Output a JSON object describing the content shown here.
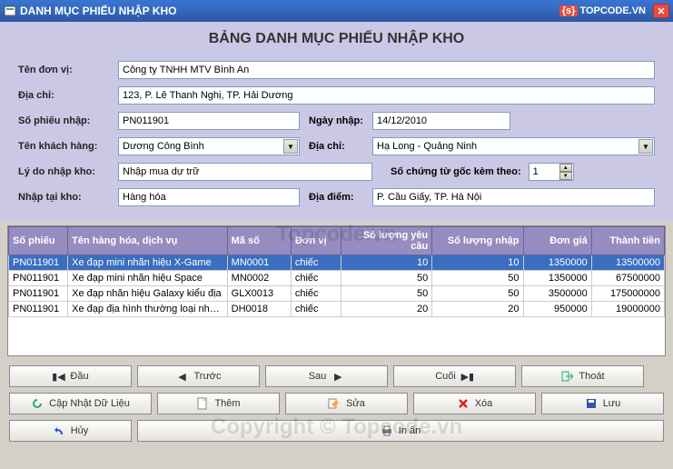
{
  "window": {
    "title": "DANH MỤC PHIẾU NHẬP KHO",
    "logo_text": "TOPCODE.VN"
  },
  "header": "BẢNG DANH MỤC PHIẾU NHẬP KHO",
  "form": {
    "ten_don_vi_label": "Tên đơn vị:",
    "ten_don_vi": "Công ty TNHH MTV Bình An",
    "dia_chi_label": "Địa chỉ:",
    "dia_chi": "123, P. Lê Thanh Nghị, TP. Hải Dương",
    "so_phieu_label": "Số phiếu nhập:",
    "so_phieu": "PN011901",
    "ngay_nhap_label": "Ngày nhập:",
    "ngay_nhap": "14/12/2010",
    "khach_hang_label": "Tên khách hàng:",
    "khach_hang": "Dương Công Bình",
    "dia_chi_kh_label": "Địa chỉ:",
    "dia_chi_kh": "Hạ Long - Quảng Ninh",
    "ly_do_label": "Lý do nhập kho:",
    "ly_do": "Nhập mua dự trữ",
    "chung_tu_label": "Số chứng từ gốc kèm theo:",
    "chung_tu": "1",
    "nhap_tai_label": "Nhập tại kho:",
    "nhap_tai": "Hàng hóa",
    "dia_diem_label": "Địa điểm:",
    "dia_diem": "P. Cầu Giấy, TP. Hà Nội"
  },
  "table": {
    "headers": [
      "Số phiếu",
      "Tên hàng hóa, dịch vụ",
      "Mã số",
      "Đơn vị",
      "Số lượng yêu cầu",
      "Số lượng nhập",
      "Đơn giá",
      "Thành tiền"
    ],
    "rows": [
      {
        "sp": "PN011901",
        "ten": "Xe đạp mini nhãn hiệu X-Game",
        "ma": "MN0001",
        "dv": "chiếc",
        "slyc": "10",
        "sln": "10",
        "dg": "1350000",
        "tt": "13500000",
        "sel": true
      },
      {
        "sp": "PN011901",
        "ten": "Xe đạp mini nhãn hiệu Space",
        "ma": "MN0002",
        "dv": "chiếc",
        "slyc": "50",
        "sln": "50",
        "dg": "1350000",
        "tt": "67500000",
        "sel": false
      },
      {
        "sp": "PN011901",
        "ten": "Xe đạp nhãn hiệu Galaxy kiểu địa",
        "ma": "GLX0013",
        "dv": "chiếc",
        "slyc": "50",
        "sln": "50",
        "dg": "3500000",
        "tt": "175000000",
        "sel": false
      },
      {
        "sp": "PN011901",
        "ten": "Xe đạp địa hình thường loại nhỏ cỡ",
        "ma": "DH0018",
        "dv": "chiếc",
        "slyc": "20",
        "sln": "20",
        "dg": "950000",
        "tt": "19000000",
        "sel": false
      }
    ]
  },
  "buttons": {
    "dau": "Đầu",
    "truoc": "Trước",
    "sau": "Sau",
    "cuoi": "Cuối",
    "thoat": "Thoát",
    "capnhat": "Cập Nhật Dữ Liệu",
    "them": "Thêm",
    "sua": "Sửa",
    "xoa": "Xóa",
    "luu": "Lưu",
    "huy": "Hủy",
    "inan": "In ấn"
  },
  "watermark1": "Topcode.vn",
  "watermark2": "Copyright © Topcode.vn"
}
